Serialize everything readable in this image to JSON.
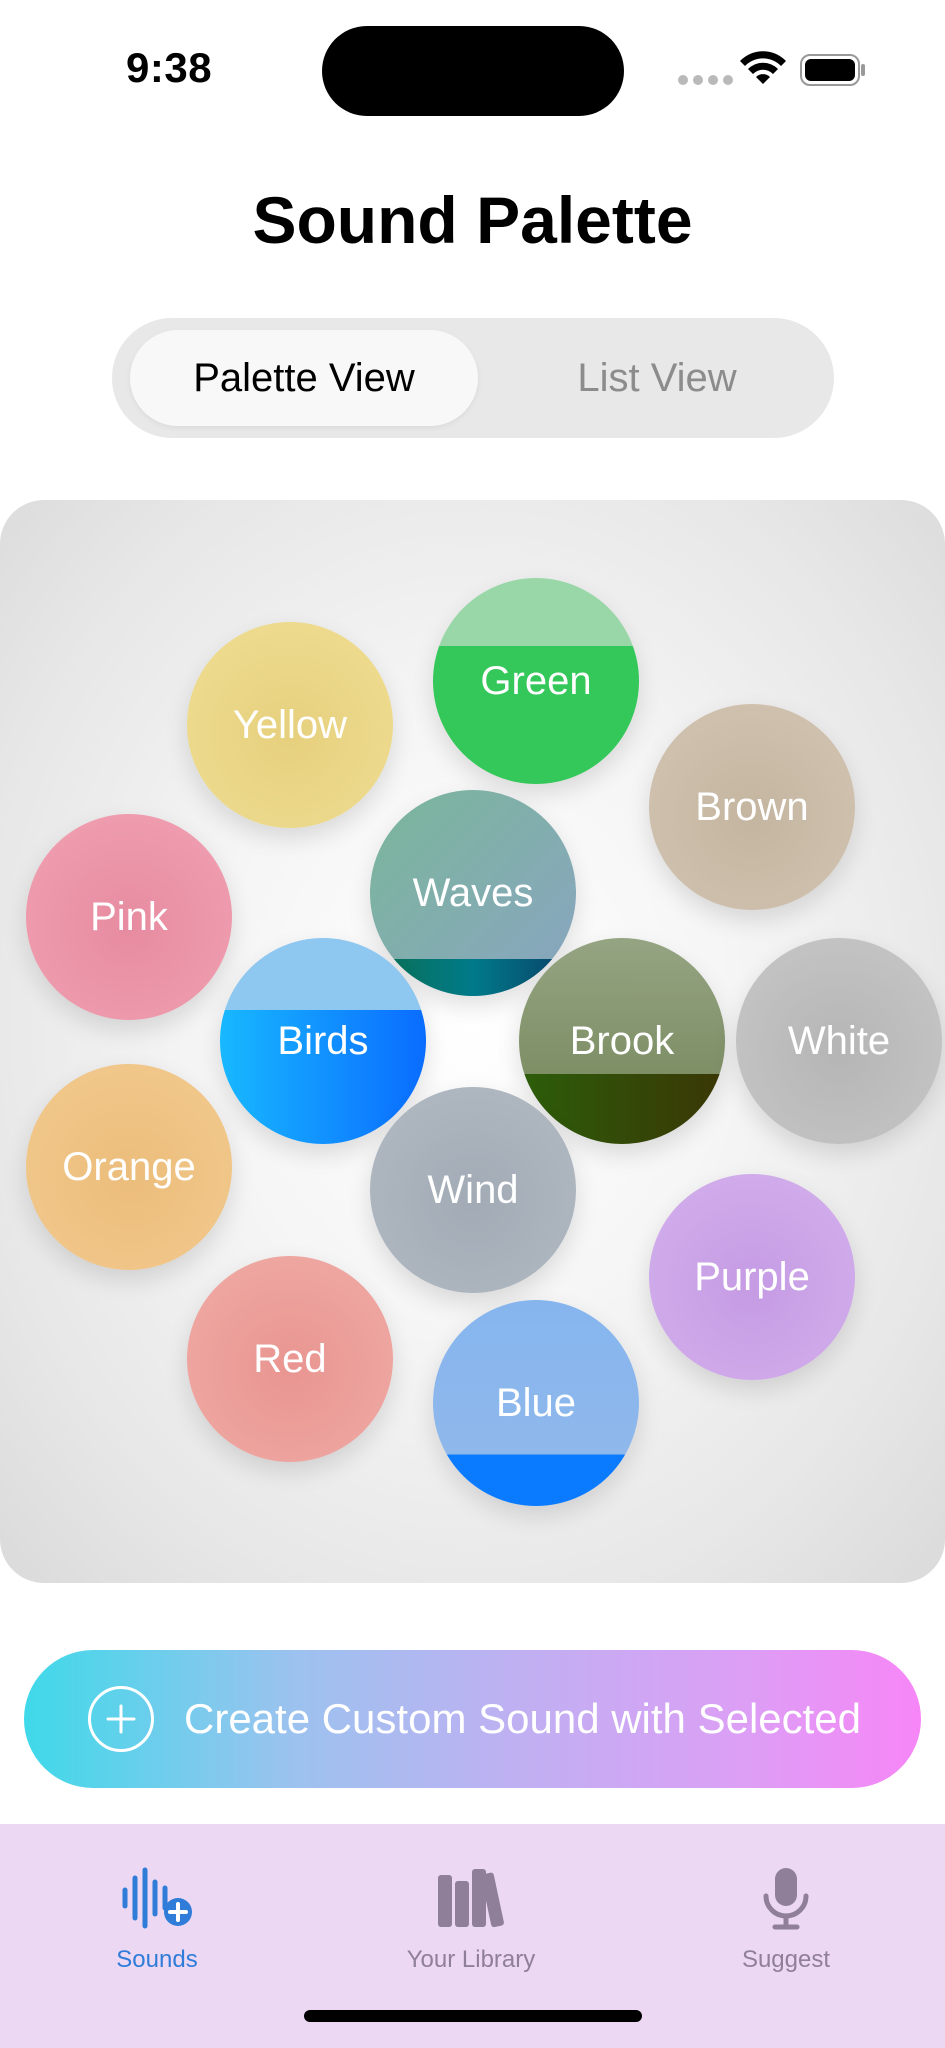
{
  "status": {
    "time": "9:38"
  },
  "title": "Sound Palette",
  "segmented": {
    "options": [
      "Palette View",
      "List View"
    ],
    "selected": "Palette View"
  },
  "palette": {
    "bubbles": [
      {
        "id": "yellow",
        "label": "Yellow",
        "color": "#e8d383"
      },
      {
        "id": "green",
        "label": "Green",
        "color": "#34c759"
      },
      {
        "id": "brown",
        "label": "Brown",
        "color": "#c9baa5"
      },
      {
        "id": "pink",
        "label": "Pink",
        "color": "#ea8fa3"
      },
      {
        "id": "waves",
        "label": "Waves",
        "color": "#7fa9a3"
      },
      {
        "id": "birds",
        "label": "Birds",
        "color": "#1f9bff"
      },
      {
        "id": "brook",
        "label": "Brook",
        "color": "#5c6e3b"
      },
      {
        "id": "white",
        "label": "White",
        "color": "#bdbdbd"
      },
      {
        "id": "orange",
        "label": "Orange",
        "color": "#efc07e"
      },
      {
        "id": "wind",
        "label": "Wind",
        "color": "#a6afb8"
      },
      {
        "id": "purple",
        "label": "Purple",
        "color": "#c9a2e6"
      },
      {
        "id": "red",
        "label": "Red",
        "color": "#ea9c98"
      },
      {
        "id": "blue",
        "label": "Blue",
        "color": "#86b5ee"
      }
    ]
  },
  "cta": {
    "label": "Create Custom Sound with Selected",
    "icon": "plus-circle-icon"
  },
  "tabs": [
    {
      "label": "Sounds",
      "icon": "waveform-plus-icon",
      "active": true,
      "color": "#2f7dd8"
    },
    {
      "label": "Your Library",
      "icon": "books-icon",
      "active": false,
      "color": "#8f7f99"
    },
    {
      "label": "Suggest",
      "icon": "microphone-icon",
      "active": false,
      "color": "#8f7f99"
    }
  ]
}
